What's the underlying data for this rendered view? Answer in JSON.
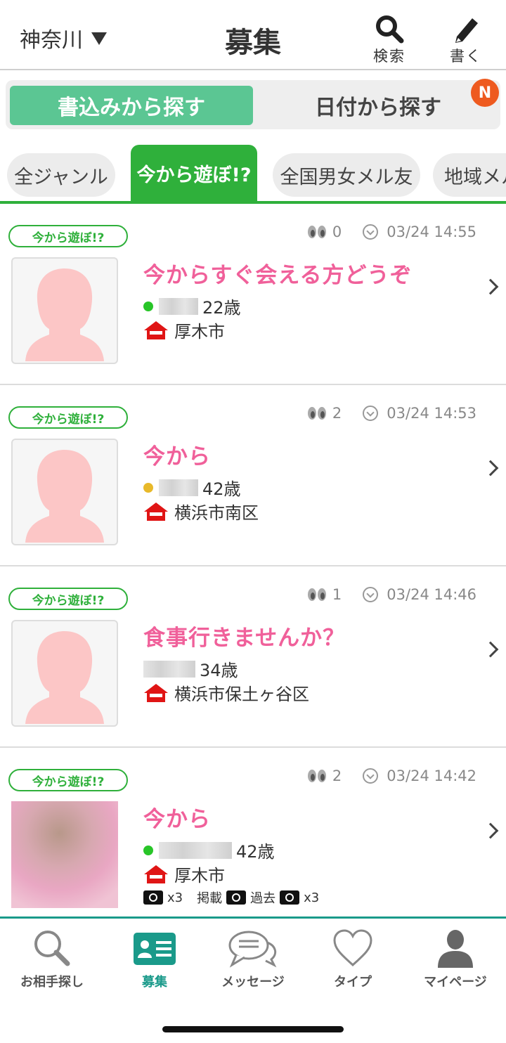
{
  "header": {
    "region": "神奈川",
    "title": "募集",
    "search_label": "検索",
    "write_label": "書く"
  },
  "segments": {
    "by_post": "書込みから探す",
    "by_date": "日付から探す",
    "new_badge": "N"
  },
  "genre_tabs": [
    {
      "label": "全ジャンル",
      "active": false
    },
    {
      "label": "今から遊ぼ!?",
      "active": true
    },
    {
      "label": "全国男女メル友",
      "active": false
    },
    {
      "label": "地域メル",
      "active": false
    }
  ],
  "posts": [
    {
      "tag": "今から遊ぼ!?",
      "views": "0",
      "date": "03/24 14:55",
      "title": "今からすぐ会える方どうぞ",
      "status": "green",
      "age": "22歳",
      "location": "厚木市"
    },
    {
      "tag": "今から遊ぼ!?",
      "views": "2",
      "date": "03/24 14:53",
      "title": "今から",
      "status": "yellow",
      "age": "42歳",
      "location": "横浜市南区"
    },
    {
      "tag": "今から遊ぼ!?",
      "views": "1",
      "date": "03/24 14:46",
      "title": "食事行きませんか？",
      "status": "none",
      "age": "34歳",
      "location": "横浜市保土ヶ谷区"
    },
    {
      "tag": "今から遊ぼ!?",
      "views": "2",
      "date": "03/24 14:42",
      "title": "今から",
      "status": "green",
      "age": "42歳",
      "location": "厚木市",
      "photos": {
        "count1": "x3",
        "label1": "掲載",
        "label2": "過去",
        "count2": "x3"
      }
    }
  ],
  "bottom_nav": [
    {
      "label": "お相手探し",
      "icon": "search-icon"
    },
    {
      "label": "募集",
      "icon": "card-icon",
      "active": true
    },
    {
      "label": "メッセージ",
      "icon": "chat-icon"
    },
    {
      "label": "タイプ",
      "icon": "heart-icon"
    },
    {
      "label": "マイページ",
      "icon": "person-icon"
    }
  ],
  "colors": {
    "accent_green": "#2fb03b",
    "segment_green": "#5bc693",
    "title_pink": "#f0609a",
    "nav_teal": "#1a9a8a"
  }
}
